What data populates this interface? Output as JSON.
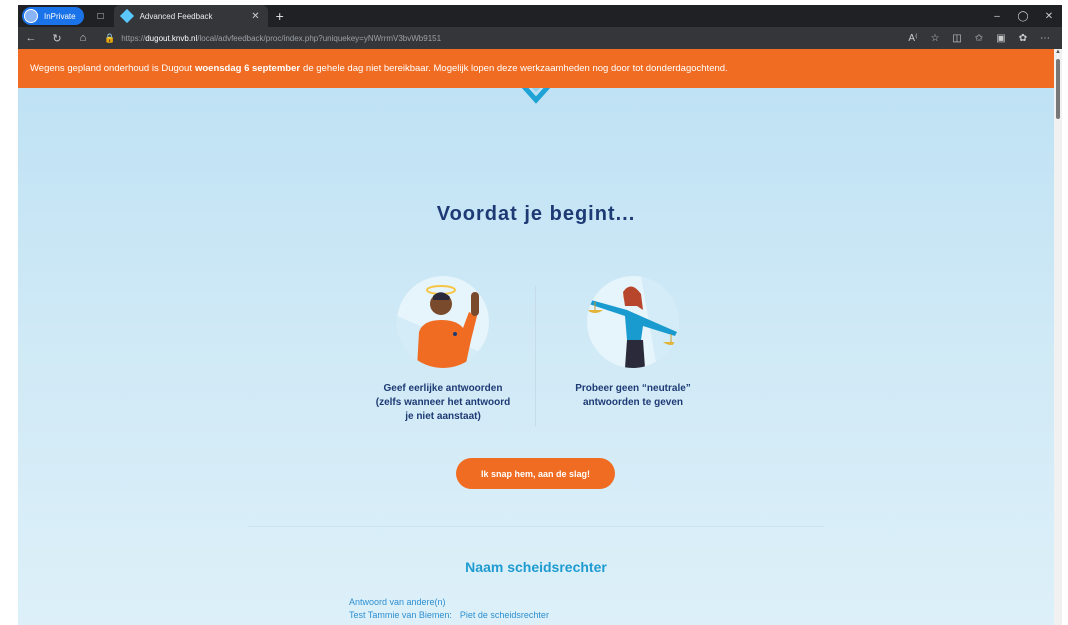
{
  "browser": {
    "inprivate_label": "InPrivate",
    "tab_title": "Advanced Feedback",
    "url_prefix": "https://",
    "url_domain": "dugout.knvb.nl",
    "url_path": "/local/advfeedback/proc/index.php?uniquekey=yNWrrmV3bvWb9151"
  },
  "banner": {
    "before": "Wegens gepland onderhoud is Dugout",
    "bold": "woensdag 6 september",
    "after": "de gehele dag niet bereikbaar. Mogelijk lopen deze werkzaamheden nog door tot donderdagochtend."
  },
  "intro": {
    "title": "Voordat je begint...",
    "tips": [
      {
        "caption": "Geef eerlijke antwoorden\n(zelfs wanneer het antwoord\nje niet aanstaat)"
      },
      {
        "caption": "Probeer geen “neutrale”\nantwoorden te geven"
      }
    ],
    "cta_label": "Ik snap hem, aan de slag!"
  },
  "section": {
    "title": "Naam scheidsrechter",
    "answers_label": "Antwoord van andere(n)",
    "rows": [
      {
        "name": "Test Tammie van Biemen:",
        "value": "Piet de scheidsrechter"
      }
    ]
  },
  "colors": {
    "accent": "#f06c22",
    "heading": "#1e3a74",
    "section_title": "#1e9bd0"
  }
}
